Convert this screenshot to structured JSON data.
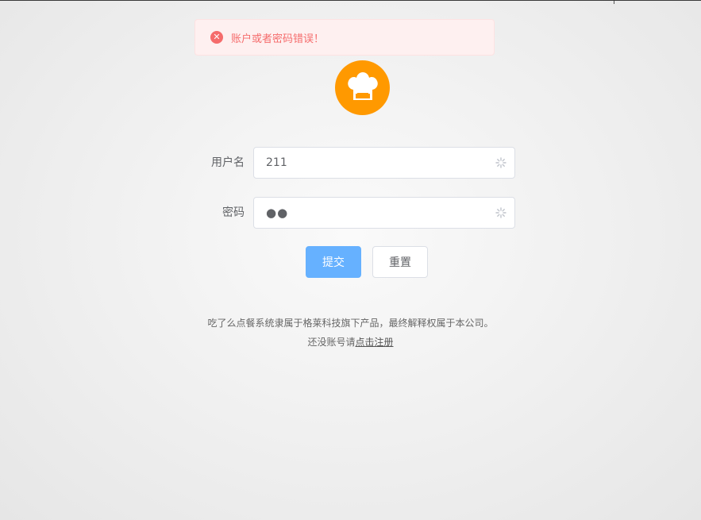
{
  "alert": {
    "icon": "close-circle-icon",
    "message": "账户或者密码错误！",
    "color": "#f56c6c"
  },
  "logo": {
    "icon": "chef-hat-icon",
    "color": "#ff9900"
  },
  "form": {
    "username_label": "用户名",
    "username_value": "211",
    "password_label": "密码",
    "password_masked": "●●"
  },
  "buttons": {
    "submit": "提交",
    "reset": "重置"
  },
  "footer": {
    "copyright": "吃了么点餐系统隶属于格莱科技旗下产品，最终解释权属于本公司。",
    "no_account_prefix": "还没账号请",
    "register_link": "点击注册"
  }
}
